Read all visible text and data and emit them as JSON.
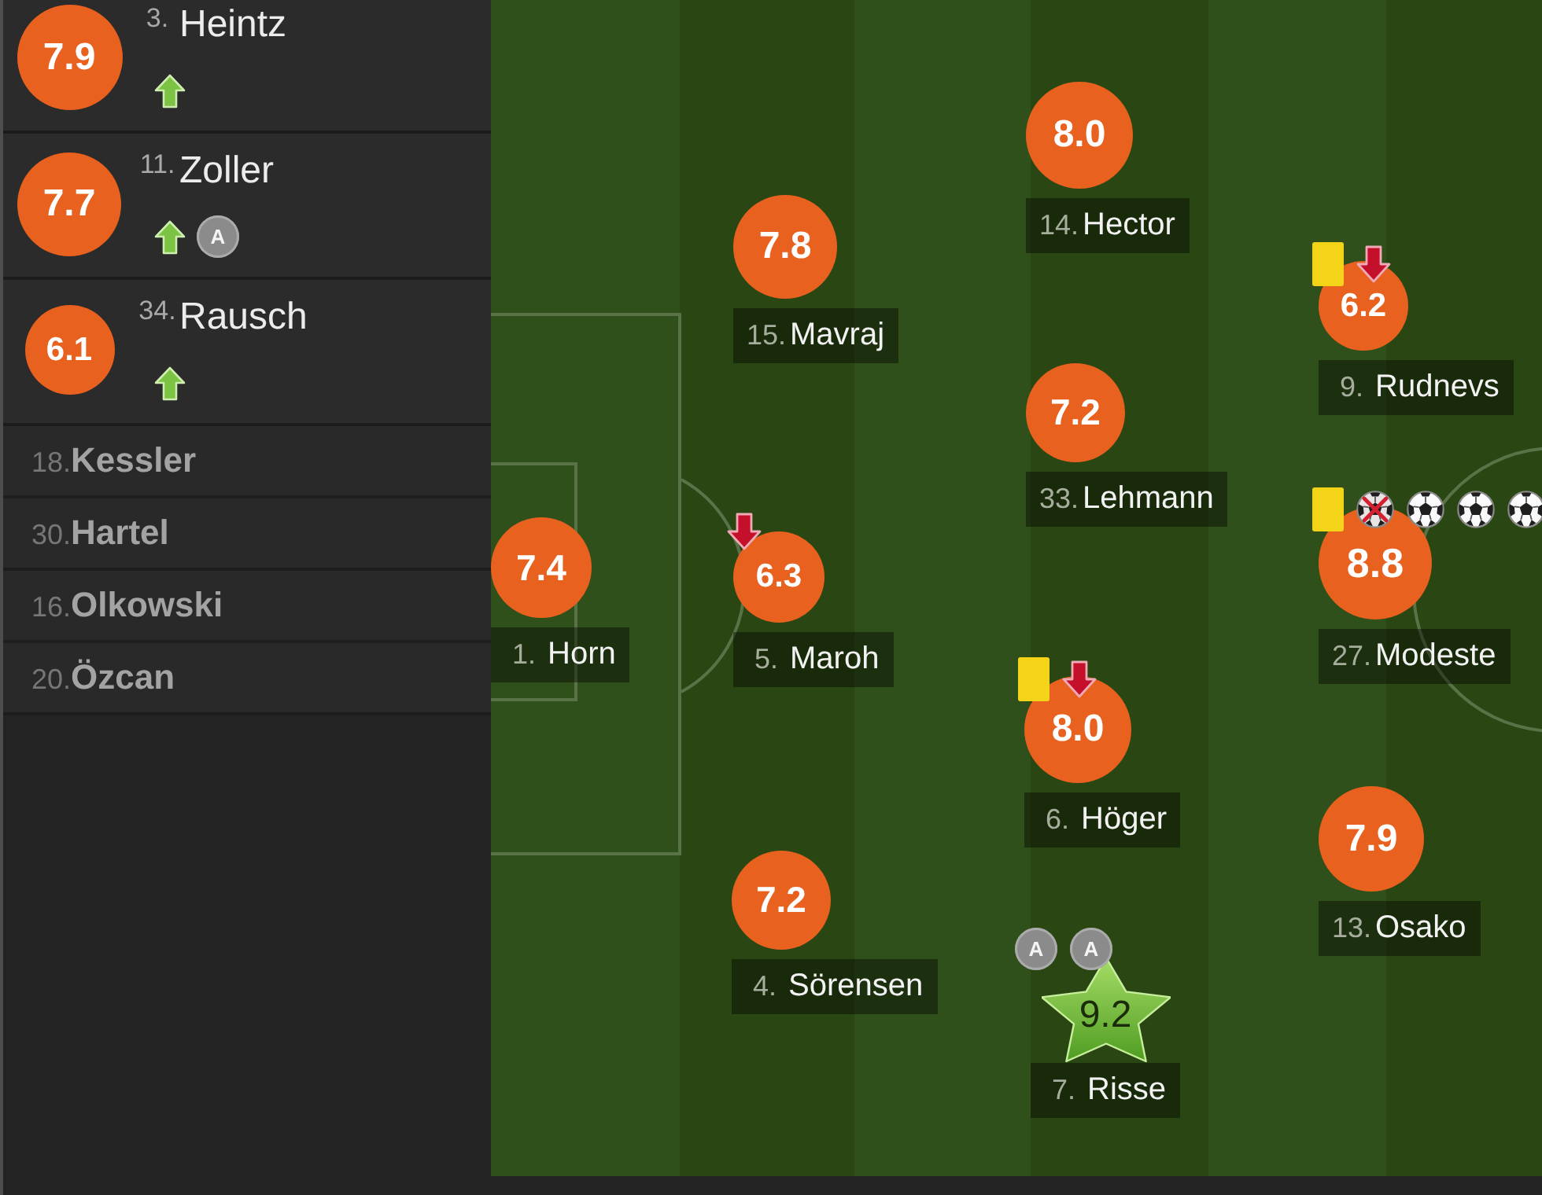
{
  "substitutes": [
    {
      "number": "3.",
      "name": "Heintz",
      "rating": "7.9",
      "events": [
        {
          "kind": "sub_in"
        }
      ]
    },
    {
      "number": "11.",
      "name": "Zoller",
      "rating": "7.7",
      "events": [
        {
          "kind": "sub_in"
        },
        {
          "kind": "assist",
          "label": "A"
        }
      ]
    },
    {
      "number": "34.",
      "name": "Rausch",
      "rating": "6.1",
      "events": [
        {
          "kind": "sub_in"
        }
      ]
    }
  ],
  "bench": [
    {
      "number": "18.",
      "name": "Kessler"
    },
    {
      "number": "30.",
      "name": "Hartel"
    },
    {
      "number": "16.",
      "name": "Olkowski"
    },
    {
      "number": "20.",
      "name": "Özcan"
    }
  ],
  "pitch": {
    "players": [
      {
        "number": "1.",
        "name": "Horn",
        "rating": "7.4",
        "man_of_the_match": false
      },
      {
        "number": "15.",
        "name": "Mavraj",
        "rating": "7.8",
        "man_of_the_match": false
      },
      {
        "number": "5.",
        "name": "Maroh",
        "rating": "6.3",
        "man_of_the_match": false,
        "events": [
          {
            "kind": "sub_out"
          }
        ]
      },
      {
        "number": "4.",
        "name": "Sörensen",
        "rating": "7.2",
        "man_of_the_match": false
      },
      {
        "number": "14.",
        "name": "Hector",
        "rating": "8.0",
        "man_of_the_match": false
      },
      {
        "number": "33.",
        "name": "Lehmann",
        "rating": "7.2",
        "man_of_the_match": false
      },
      {
        "number": "6.",
        "name": "Höger",
        "rating": "8.0",
        "man_of_the_match": false,
        "events": [
          {
            "kind": "yellow_card"
          },
          {
            "kind": "sub_out"
          }
        ]
      },
      {
        "number": "7.",
        "name": "Risse",
        "rating": "9.2",
        "man_of_the_match": true,
        "events": [
          {
            "kind": "assist",
            "label": "A"
          },
          {
            "kind": "assist",
            "label": "A"
          }
        ]
      },
      {
        "number": "9.",
        "name": "Rudnevs",
        "rating": "6.2",
        "man_of_the_match": false,
        "events": [
          {
            "kind": "yellow_card"
          },
          {
            "kind": "sub_out"
          }
        ]
      },
      {
        "number": "27.",
        "name": "Modeste",
        "rating": "8.8",
        "man_of_the_match": false,
        "events": [
          {
            "kind": "yellow_card"
          },
          {
            "kind": "crossed_ball"
          },
          {
            "kind": "goal"
          },
          {
            "kind": "goal"
          },
          {
            "kind": "goal"
          }
        ]
      },
      {
        "number": "13.",
        "name": "Osako",
        "rating": "7.9",
        "man_of_the_match": false
      }
    ]
  }
}
